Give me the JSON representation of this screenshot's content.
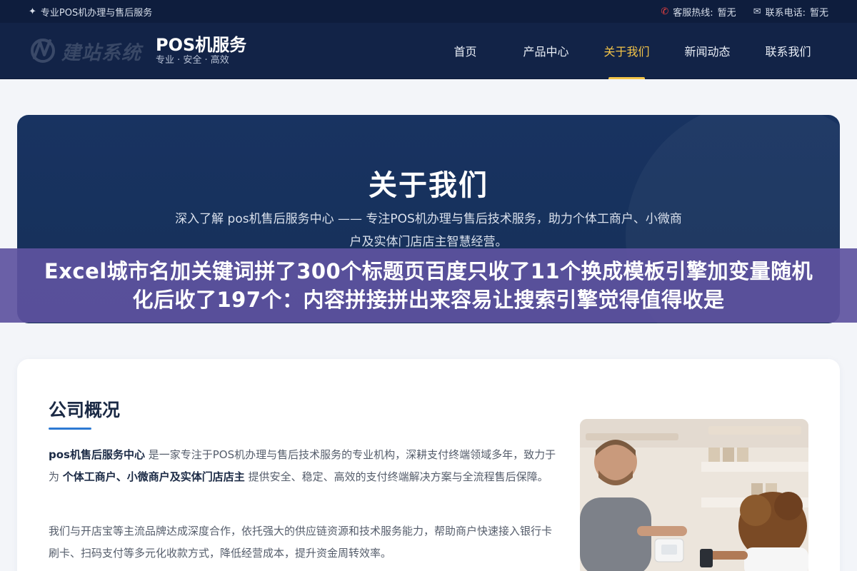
{
  "topbar": {
    "tagline": "专业POS机办理与售后服务",
    "hotline_label": "客服热线:",
    "hotline_value": "暂无",
    "phone_label": "联系电话:",
    "phone_value": "暂无"
  },
  "header": {
    "logo_text": "建站系统",
    "brand_name": "POS机服务",
    "brand_slogan": "专业 · 安全 · 高效",
    "nav": [
      {
        "label": "首页"
      },
      {
        "label": "产品中心"
      },
      {
        "label": "关于我们"
      },
      {
        "label": "新闻动态"
      },
      {
        "label": "联系我们"
      }
    ]
  },
  "hero": {
    "title": "关于我们",
    "description": "深入了解 pos机售后服务中心 —— 专注POS机办理与售后技术服务，助力个体工商户、小微商户及实体门店店主智慧经营。"
  },
  "overlay": {
    "text": "Excel城市名加关键词拼了300个标题页百度只收了11个换成模板引擎加变量随机化后收了197个：内容拼接拼出来容易让搜索引擎觉得值得收是"
  },
  "company": {
    "title": "公司概况",
    "p1_strong1": "pos机售后服务中心",
    "p1_text1": " 是一家专注于POS机办理与售后技术服务的专业机构，深耕支付终端领域多年，致力于为 ",
    "p1_strong2": "个体工商户、小微商户及实体门店店主",
    "p1_text2": " 提供安全、稳定、高效的支付终端解决方案与全流程售后保障。",
    "p2": "我们与开店宝等主流品牌达成深度合作，依托强大的供应链资源和技术服务能力，帮助商户快速接入银行卡刷卡、扫码支付等多元化收款方式，降低经营成本，提升资金周转效率。"
  },
  "colors": {
    "topbar_bg": "#0e1d3d",
    "header_bg": "#122347",
    "active_nav": "#f3c448",
    "hero_bg": "#183361",
    "overlay_bg": "#5e52a0",
    "accent_line": "#2d7ad3"
  }
}
